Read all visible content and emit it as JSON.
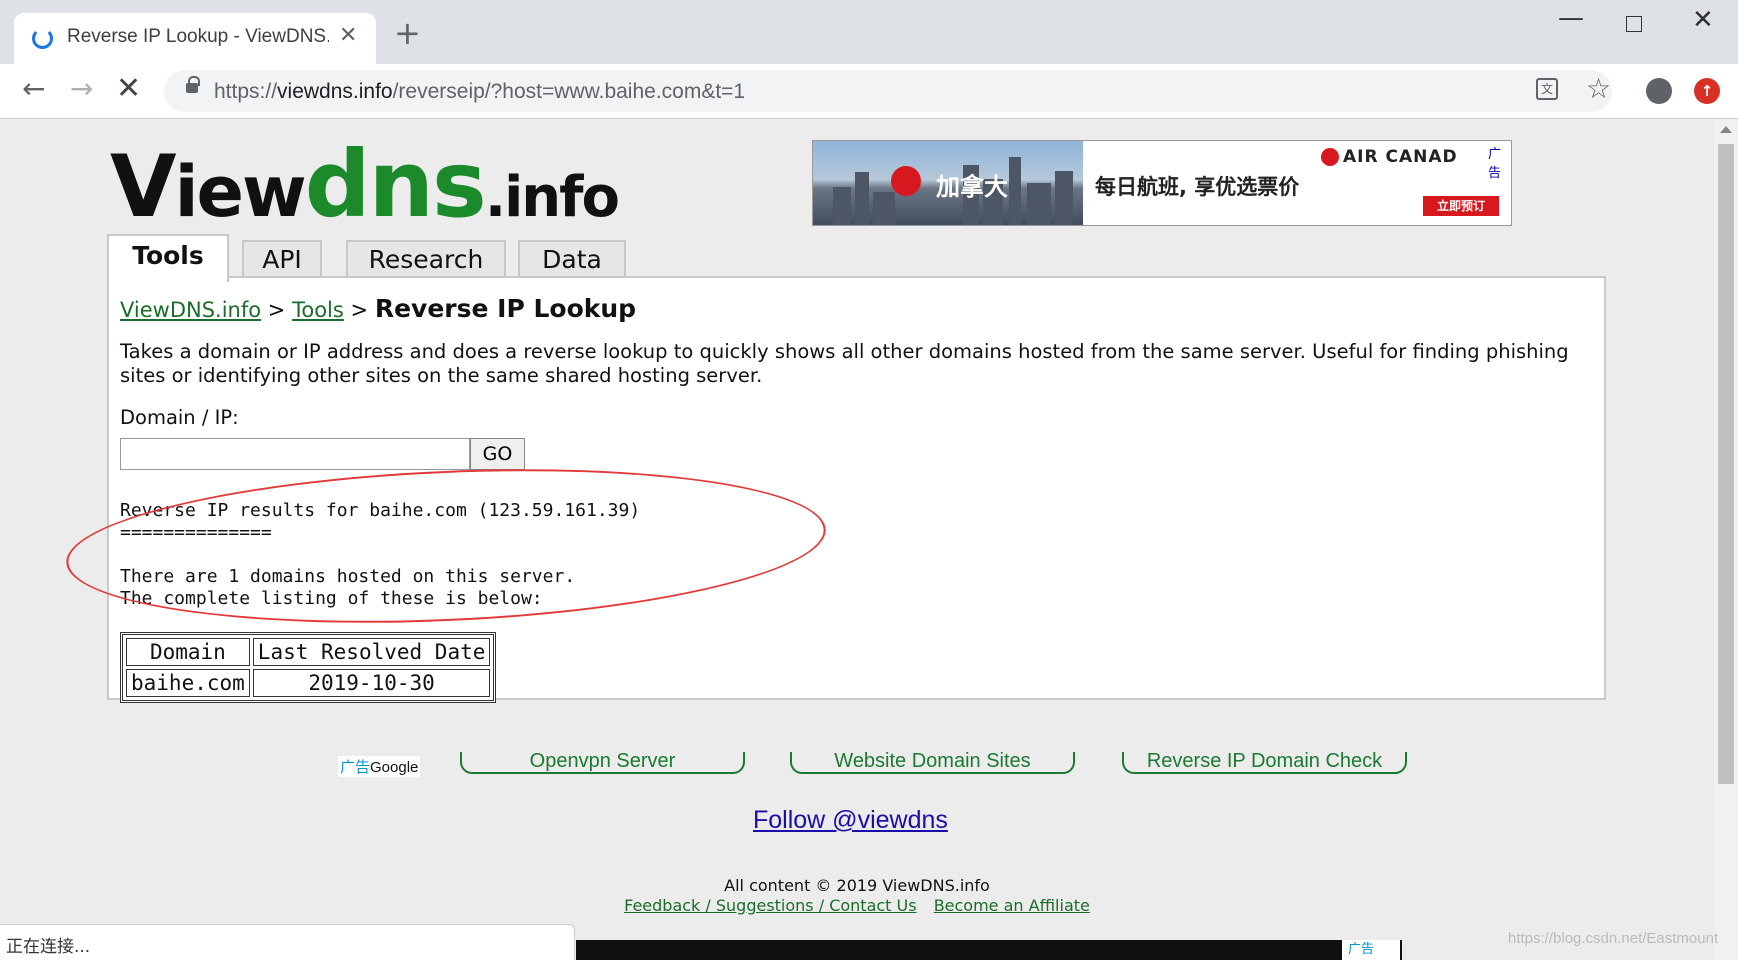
{
  "browser": {
    "tab_title": "Reverse IP Lookup - ViewDNS.",
    "tab_close": "✕",
    "new_tab": "+",
    "url_scheme": "https://",
    "url_host": "viewdns.info",
    "url_path": "/reverseip/?host=www.baihe.com&t=1",
    "icons": {
      "loading": "loading-spinner-icon",
      "back": "back-arrow-icon",
      "forward": "forward-arrow-icon",
      "stop": "stop-icon",
      "lock": "lock-icon",
      "translate": "translate-icon",
      "bookmark": "star-icon",
      "account": "account-icon",
      "update": "update-icon"
    }
  },
  "site": {
    "logo": {
      "v": "V",
      "iew": "iew",
      "dns": "dns",
      "info": ".info"
    },
    "logo_green": "#1a8a2b"
  },
  "banner_ad": {
    "city": "加拿大",
    "slogan": "每日航班, 享优选票价",
    "brand": "AIR CANAD",
    "ad_label": "广告",
    "cta": "立即预订",
    "brand_color": "#d7191f"
  },
  "nav_tabs": [
    {
      "label": "Tools",
      "active": true
    },
    {
      "label": "API",
      "active": false
    },
    {
      "label": "Research",
      "active": false
    },
    {
      "label": "Data",
      "active": false
    }
  ],
  "breadcrumb": {
    "home": "ViewDNS.info",
    "sep1": ">",
    "section": "Tools",
    "sep2": ">",
    "current": "Reverse IP Lookup"
  },
  "description": "Takes a domain or IP address and does a reverse lookup to quickly shows all other domains hosted from the same server. Useful for finding phishing sites or identifying other sites on the same shared hosting server.",
  "form": {
    "label": "Domain / IP:",
    "input_value": "",
    "button": "GO"
  },
  "results": {
    "line1": "Reverse IP results for baihe.com (123.59.161.39)",
    "line2": "==============",
    "line3": "",
    "line4": "There are 1 domains hosted on this server.",
    "line5": "The complete listing of these is below:"
  },
  "result_table": {
    "headers": [
      "Domain",
      "Last Resolved Date"
    ],
    "rows": [
      [
        "baihe.com",
        "2019-10-30"
      ]
    ]
  },
  "ad_links": {
    "label_ad": "广告",
    "label_google": "Google",
    "items": [
      "Openvpn Server",
      "Website Domain Sites",
      "Reverse IP Domain Check"
    ]
  },
  "footer": {
    "follow": "Follow @viewdns",
    "copyright": "All content © 2019 ViewDNS.info",
    "feedback": "Feedback / Suggestions / Contact Us",
    "affiliate": "Become an Affiliate"
  },
  "status_bar": "正在连接...",
  "bottom_ad_label": "广告",
  "watermark": "https://blog.csdn.net/Eastmount"
}
